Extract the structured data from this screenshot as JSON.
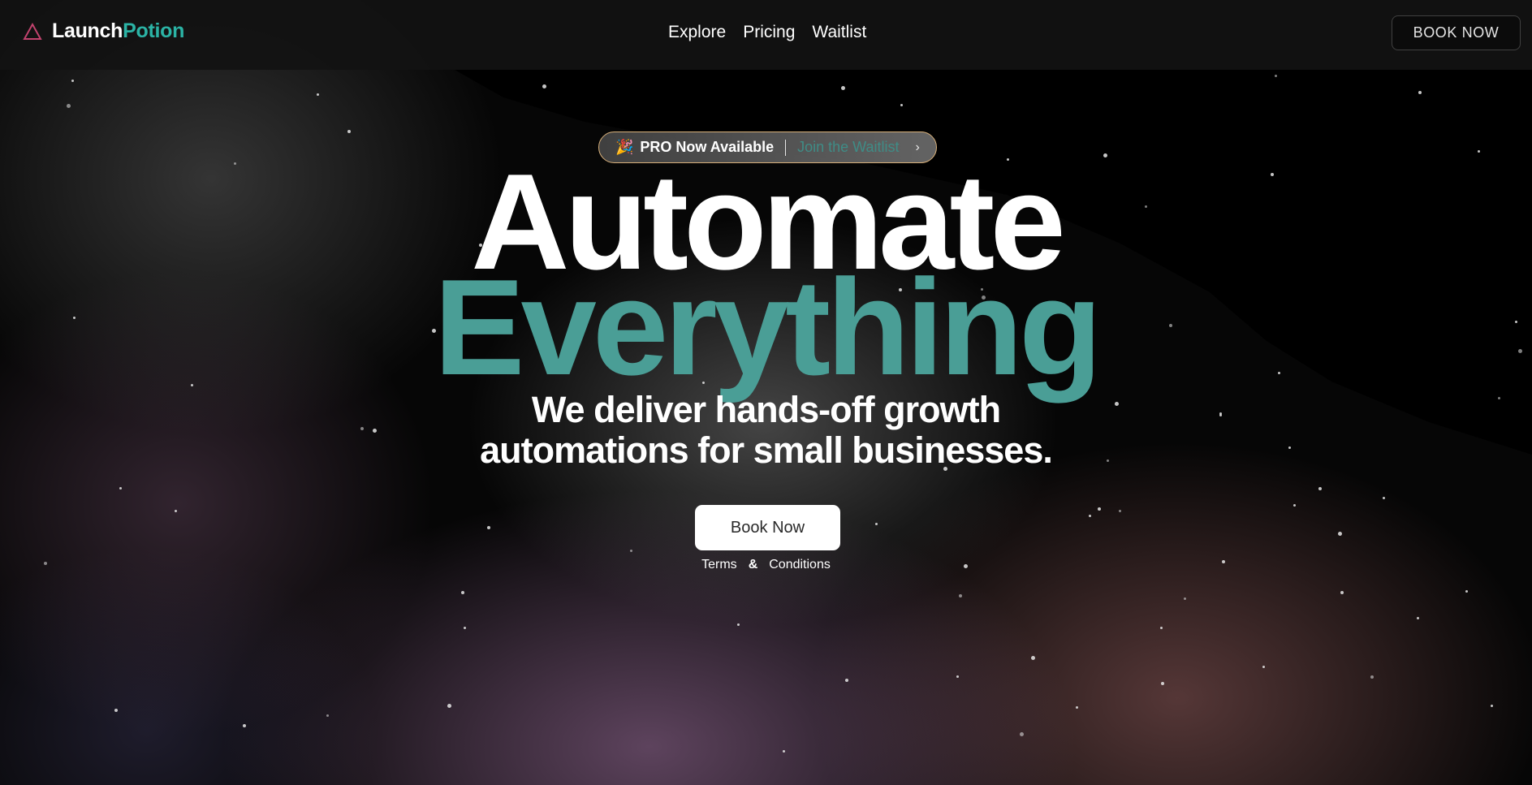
{
  "brand": {
    "name_part1": "Launch",
    "name_part2": "Potion",
    "logo_icon": "triangle-icon",
    "accent_color": "#2bb3a5"
  },
  "nav": {
    "items": [
      {
        "label": "Explore"
      },
      {
        "label": "Pricing"
      },
      {
        "label": "Waitlist"
      }
    ]
  },
  "header": {
    "book_label": "BOOK NOW"
  },
  "announcement": {
    "icon": "party-popper-icon",
    "emoji": "🎉",
    "title": "PRO Now Available",
    "link": "Join the Waitlist",
    "chevron": "›"
  },
  "hero": {
    "line1": "Automate",
    "line2": "Everything",
    "sub_line1": "We deliver hands-off growth",
    "sub_line2": "automations for small businesses.",
    "cta_label": "Book Now",
    "terms_label": "Terms",
    "terms_amp": "&",
    "conditions_label": "Conditions",
    "headline_accent_color": "#4a9e96"
  }
}
